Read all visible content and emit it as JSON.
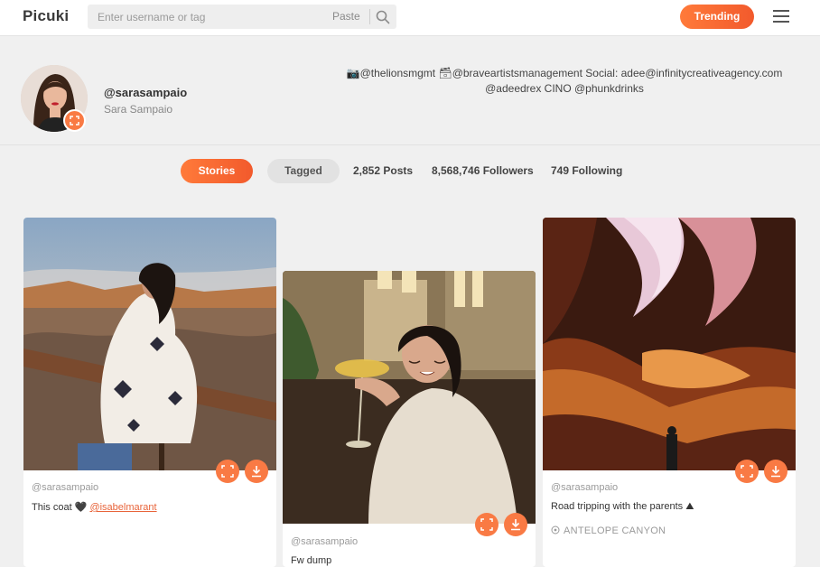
{
  "header": {
    "logo": "Picuki",
    "search_placeholder": "Enter username or tag",
    "paste_label": "Paste",
    "trending_label": "Trending",
    "icons": [
      "search-icon",
      "menu-icon"
    ]
  },
  "profile": {
    "username": "@sarasampaio",
    "fullname": "Sara Sampaio",
    "bio": "📷@thelionsmgmt 🗃@braveartistsmanagement Social: adee@infinitycreativeagency.com @adeedrex CINO @phunkdrinks"
  },
  "tabs": {
    "stories": "Stories",
    "tagged": "Tagged"
  },
  "stats": {
    "posts": "2,852 Posts",
    "followers": "8,568,746 Followers",
    "following": "749 Following"
  },
  "posts": [
    {
      "author": "@sarasampaio",
      "caption_text": "This coat 🖤 ",
      "caption_link": "@isabelmarant",
      "location": ""
    },
    {
      "author": "@sarasampaio",
      "caption_text": "Fw dump",
      "caption_link": "",
      "location": ""
    },
    {
      "author": "@sarasampaio",
      "caption_text": "Road tripping with the parents ⛰",
      "caption_link": "",
      "location": "ANTELOPE CANYON"
    }
  ],
  "colors": {
    "accent": "#f97a44",
    "accent_dark": "#f25a2c",
    "background": "#f0f0f0"
  }
}
